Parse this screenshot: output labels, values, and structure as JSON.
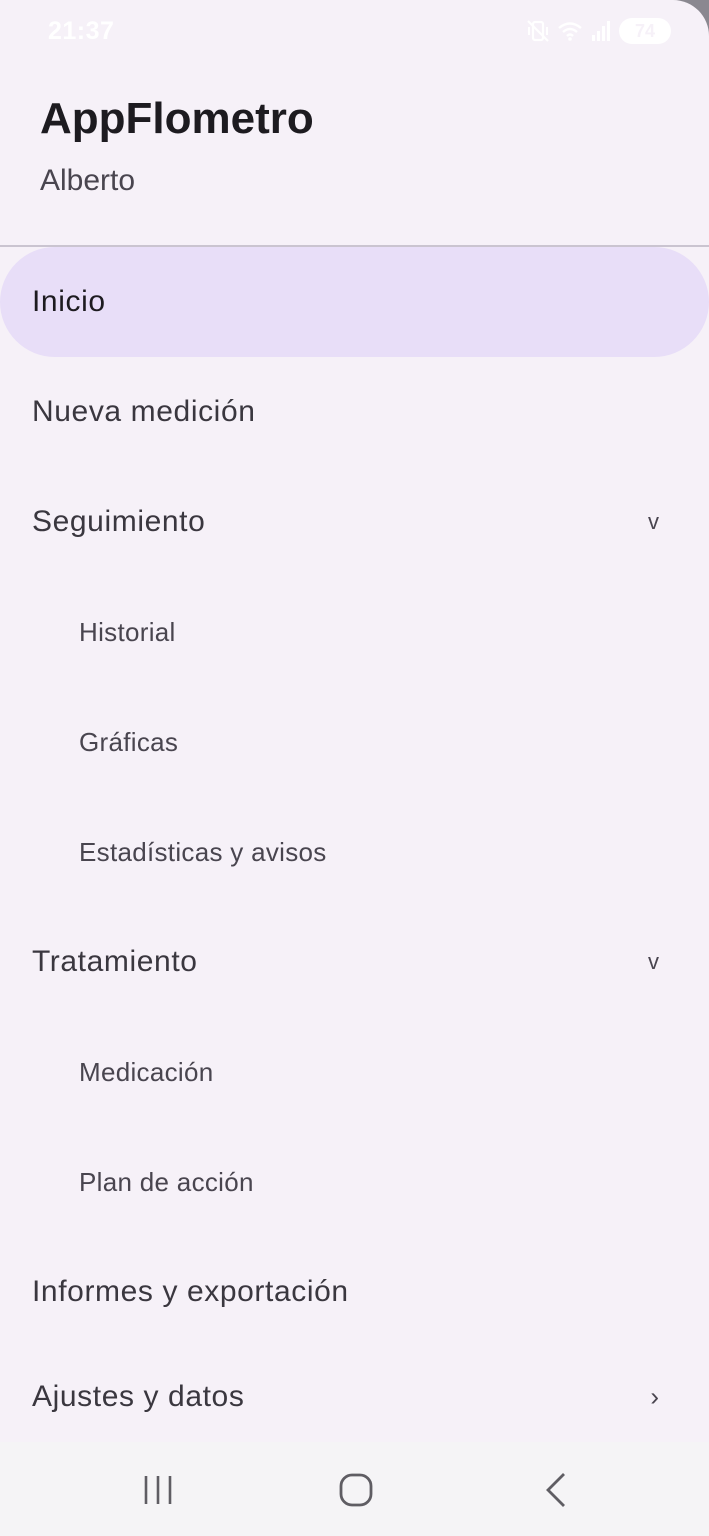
{
  "status_bar": {
    "time": "21:37",
    "battery": "74",
    "icons": [
      "mute-vibrate-icon",
      "wifi-icon",
      "signal-icon",
      "battery-icon"
    ]
  },
  "header": {
    "app_title": "AppFlometro",
    "user_name": "Alberto"
  },
  "menu": {
    "items": [
      {
        "label": "Inicio",
        "selected": true
      },
      {
        "label": "Nueva medición"
      },
      {
        "label": "Seguimiento",
        "chevron": "v"
      },
      {
        "label": "Historial"
      },
      {
        "label": "Gráficas"
      },
      {
        "label": "Estadísticas y avisos"
      },
      {
        "label": "Tratamiento",
        "chevron": "v"
      },
      {
        "label": "Medicación"
      },
      {
        "label": "Plan de acción"
      },
      {
        "label": "Informes y exportación"
      },
      {
        "label": "Ajustes y datos",
        "chevron": "›"
      }
    ]
  },
  "nav_bar": {
    "icons": [
      "recent-apps-icon",
      "home-icon",
      "back-icon"
    ]
  },
  "colors": {
    "drawer_bg": "#f6f1f8",
    "selected_bg": "#e8def8",
    "text_primary": "#1d1b20",
    "text_secondary": "#49454f"
  }
}
